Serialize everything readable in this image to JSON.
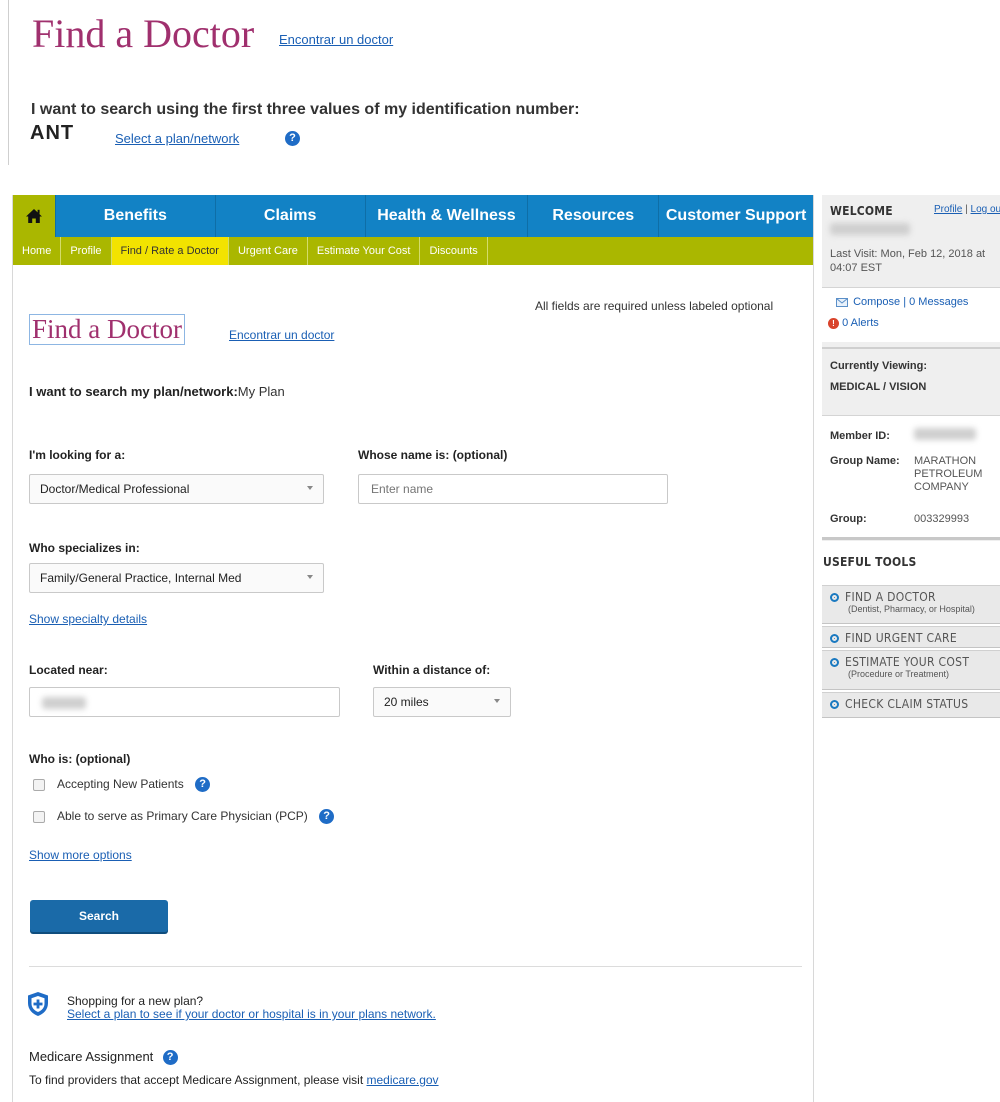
{
  "header": {
    "title": "Find a Doctor",
    "spanish_link": "Encontrar un doctor",
    "prompt": "I want to search using the first three values of my identification number:",
    "prefix": "ANT",
    "select_plan_link": "Select a plan/network"
  },
  "nav": {
    "items": [
      {
        "label": "Benefits"
      },
      {
        "label": "Claims"
      },
      {
        "label": "Health & Wellness"
      },
      {
        "label": "Resources"
      },
      {
        "label": "Customer Support"
      }
    ]
  },
  "subnav": {
    "items": [
      {
        "label": "Home"
      },
      {
        "label": "Profile"
      },
      {
        "label": "Find / Rate a Doctor"
      },
      {
        "label": "Urgent Care"
      },
      {
        "label": "Estimate Your Cost"
      },
      {
        "label": "Discounts"
      }
    ]
  },
  "form": {
    "required_note": "All fields are required unless labeled optional",
    "title": "Find a Doctor",
    "spanish_link": "Encontrar un doctor",
    "plan_label": "I want to search my plan/network:",
    "plan_value": "My Plan",
    "looking_for_label": "I'm looking for a:",
    "looking_for_value": "Doctor/Medical Professional",
    "name_label": "Whose name is: (optional)",
    "name_placeholder": "Enter name",
    "specialty_label": "Who specializes in:",
    "specialty_value": "Family/General Practice, Internal Med",
    "specialty_details_link": "Show specialty details",
    "located_label": "Located near:",
    "distance_label": "Within a distance of:",
    "distance_value": "20 miles",
    "who_is_label": "Who is: (optional)",
    "accepting_label": "Accepting New Patients",
    "pcp_label": "Able to serve as Primary Care Physician (PCP)",
    "more_options_link": "Show more options",
    "search_button": "Search",
    "shopping_text": "Shopping for a new plan?",
    "shopping_link": "Select a plan to see if your doctor or hospital is in your plans network.",
    "medicare_title": "Medicare Assignment",
    "medicare_text": "To find providers that accept Medicare Assignment, please visit",
    "medicare_link": "medicare.gov"
  },
  "sidebar": {
    "welcome": "WELCOME",
    "profile_link": "Profile",
    "separator": "|",
    "logout_link": "Log out",
    "last_visit": "Last Visit: Mon, Feb 12, 2018 at 04:07 EST",
    "compose_link": "Compose",
    "messages_link": "0 Messages",
    "alerts_link": "0 Alerts",
    "currently_viewing_label": "Currently Viewing:",
    "currently_viewing_value": "MEDICAL / VISION",
    "member_id_label": "Member ID:",
    "group_name_label": "Group Name:",
    "group_name_value": "MARATHON PETROLEUM COMPANY",
    "group_label": "Group:",
    "group_value": "003329993",
    "useful_tools": "USEFUL TOOLS",
    "tools": [
      {
        "title": "Find a Doctor",
        "sub": "(Dentist, Pharmacy, or Hospital)"
      },
      {
        "title": "Find Urgent Care",
        "sub": ""
      },
      {
        "title": "Estimate Your Cost",
        "sub": "(Procedure or Treatment)"
      },
      {
        "title": "Check Claim Status",
        "sub": ""
      }
    ]
  },
  "colors": {
    "title": "#a0306e",
    "nav_blue": "#1282c5",
    "nav_green": "#aab700",
    "subnav_active": "#f2e300",
    "link": "#1a5fb4"
  }
}
